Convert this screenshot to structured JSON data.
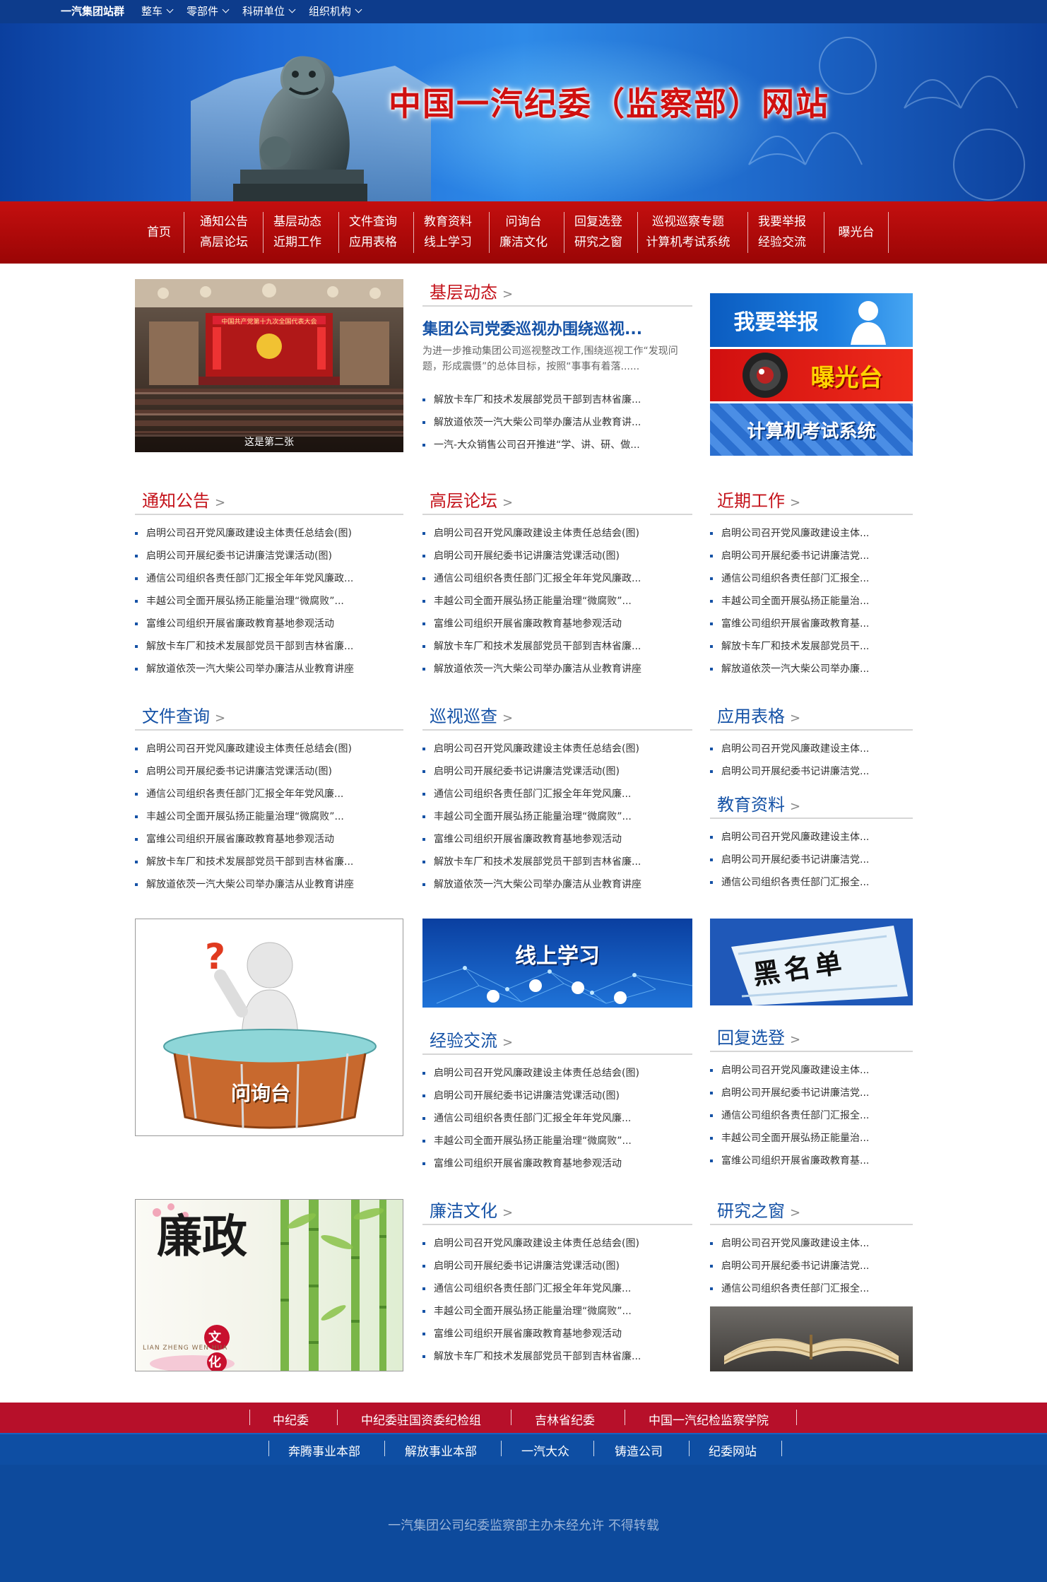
{
  "topbar": {
    "brand": "一汽集团站群",
    "menus": [
      "整车",
      "零部件",
      "科研单位",
      "组织机构"
    ]
  },
  "banner": {
    "title": "中国一汽纪委（监察部）网站"
  },
  "nav": {
    "home": "首页",
    "columns": [
      [
        "通知公告",
        "高层论坛"
      ],
      [
        "基层动态",
        "近期工作"
      ],
      [
        "文件查询",
        "应用表格"
      ],
      [
        "教育资料",
        "线上学习"
      ],
      [
        "问询台",
        "廉洁文化"
      ],
      [
        "回复选登",
        "研究之窗"
      ],
      [
        "巡视巡察专题",
        "计算机考试系统"
      ],
      [
        "我要举报",
        "经验交流"
      ]
    ],
    "last": "曝光台"
  },
  "slider": {
    "caption": "这是第二张",
    "photo_text": "中国共产党第十九次全国代表大会"
  },
  "jiceng": {
    "heading": "基层动态",
    "headline": "集团公司党委巡视办围绕巡视...",
    "summary": "为进一步推动集团公司巡视整改工作,围绕巡视工作“发现问题，形成震慑”的总体目标，按照“事事有着落......",
    "items": [
      "解放卡车厂和技术发展部党员干部到吉林省廉...",
      "解放道依茨一汽大柴公司举办廉洁从业教育讲...",
      "一汽-大众销售公司召开推进“学、讲、研、做..."
    ]
  },
  "side_buttons": {
    "report": "我要举报",
    "expose": "曝光台",
    "exam": "计算机考试系统"
  },
  "sections": {
    "tongzhi": {
      "heading": "通知公告",
      "items": [
        "启明公司召开党风廉政建设主体责任总结会(图)",
        "启明公司开展纪委书记讲廉洁党课活动(图)",
        "通信公司组织各责任部门汇报全年年党风廉政...",
        "丰越公司全面开展弘扬正能量治理“微腐败”...",
        "富维公司组织开展省廉政教育基地参观活动",
        "解放卡车厂和技术发展部党员干部到吉林省廉...",
        "解放道依茨一汽大柴公司举办廉洁从业教育讲座"
      ]
    },
    "gaoceng": {
      "heading": "高层论坛",
      "items": [
        "启明公司召开党风廉政建设主体责任总结会(图)",
        "启明公司开展纪委书记讲廉洁党课活动(图)",
        "通信公司组织各责任部门汇报全年年党风廉政...",
        "丰越公司全面开展弘扬正能量治理“微腐败”...",
        "富维公司组织开展省廉政教育基地参观活动",
        "解放卡车厂和技术发展部党员干部到吉林省廉...",
        "解放道依茨一汽大柴公司举办廉洁从业教育讲座"
      ]
    },
    "jinqi": {
      "heading": "近期工作",
      "items": [
        "启明公司召开党风廉政建设主体...",
        "启明公司开展纪委书记讲廉洁党...",
        "通信公司组织各责任部门汇报全...",
        "丰越公司全面开展弘扬正能量治...",
        "富维公司组织开展省廉政教育基...",
        "解放卡车厂和技术发展部党员干...",
        "解放道依茨一汽大柴公司举办廉..."
      ]
    },
    "wenjian": {
      "heading": "文件查询",
      "items": [
        "启明公司召开党风廉政建设主体责任总结会(图)",
        "启明公司开展纪委书记讲廉洁党课活动(图)",
        "通信公司组织各责任部门汇报全年年党风廉...",
        "丰越公司全面开展弘扬正能量治理“微腐败”...",
        "富维公司组织开展省廉政教育基地参观活动",
        "解放卡车厂和技术发展部党员干部到吉林省廉...",
        "解放道依茨一汽大柴公司举办廉洁从业教育讲座"
      ]
    },
    "xunshi": {
      "heading": "巡视巡查",
      "items": [
        "启明公司召开党风廉政建设主体责任总结会(图)",
        "启明公司开展纪委书记讲廉洁党课活动(图)",
        "通信公司组织各责任部门汇报全年年党风廉...",
        "丰越公司全面开展弘扬正能量治理“微腐败”...",
        "富维公司组织开展省廉政教育基地参观活动",
        "解放卡车厂和技术发展部党员干部到吉林省廉...",
        "解放道依茨一汽大柴公司举办廉洁从业教育讲座"
      ]
    },
    "yingyong": {
      "heading": "应用表格",
      "items": [
        "启明公司召开党风廉政建设主体...",
        "启明公司开展纪委书记讲廉洁党..."
      ]
    },
    "jiaoyu": {
      "heading": "教育资料",
      "items": [
        "启明公司召开党风廉政建设主体...",
        "启明公司开展纪委书记讲廉洁党...",
        "通信公司组织各责任部门汇报全..."
      ]
    },
    "jingyan": {
      "heading": "经验交流",
      "items": [
        "启明公司召开党风廉政建设主体责任总结会(图)",
        "启明公司开展纪委书记讲廉洁党课活动(图)",
        "通信公司组织各责任部门汇报全年年党风廉...",
        "丰越公司全面开展弘扬正能量治理“微腐败”...",
        "富维公司组织开展省廉政教育基地参观活动"
      ]
    },
    "huifu": {
      "heading": "回复选登",
      "items": [
        "启明公司召开党风廉政建设主体...",
        "启明公司开展纪委书记讲廉洁党...",
        "通信公司组织各责任部门汇报全...",
        "丰越公司全面开展弘扬正能量治...",
        "富维公司组织开展省廉政教育基..."
      ]
    },
    "lianjie": {
      "heading": "廉洁文化",
      "items": [
        "启明公司召开党风廉政建设主体责任总结会(图)",
        "启明公司开展纪委书记讲廉洁党课活动(图)",
        "通信公司组织各责任部门汇报全年年党风廉...",
        "丰越公司全面开展弘扬正能量治理“微腐败”...",
        "富维公司组织开展省廉政教育基地参观活动",
        "解放卡车厂和技术发展部党员干部到吉林省廉..."
      ]
    },
    "yanjiu": {
      "heading": "研究之窗",
      "items": [
        "启明公司召开党风廉政建设主体...",
        "启明公司开展纪委书记讲廉洁党...",
        "通信公司组织各责任部门汇报全..."
      ]
    }
  },
  "promo": {
    "wenxuntai": "问询台",
    "online": "线上学习",
    "blacklist": "黑名单",
    "lianzheng_big": "廉政",
    "lianzheng_small": "文化",
    "lianzheng_pinyin": "LIAN ZHENG WEN HUA"
  },
  "footer": {
    "row1": [
      "中纪委",
      "中纪委驻国资委纪检组",
      "吉林省纪委",
      "中国一汽纪检监察学院"
    ],
    "row2": [
      "奔腾事业本部",
      "解放事业本部",
      "一汽大众",
      "铸造公司",
      "纪委网站"
    ],
    "copyright": "一汽集团公司纪委监察部主办未经允许 不得转载"
  },
  "colors": {
    "topbar": "#0d3c8c",
    "nav_red": "#b10a0a",
    "heading_blue": "#1552a6",
    "heading_red": "#c4121a",
    "footer_red": "#b7102a",
    "footer_blue": "#0d4a9c"
  }
}
